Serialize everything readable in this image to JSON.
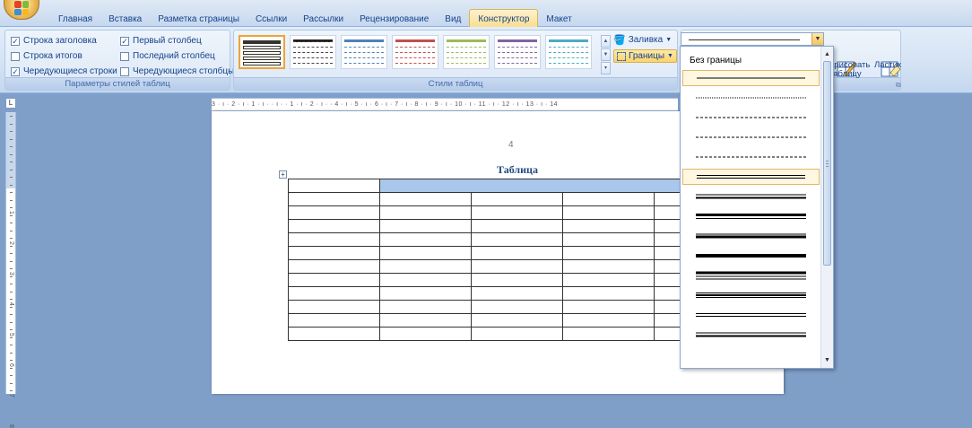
{
  "tabs": [
    {
      "label": "Главная",
      "active": false
    },
    {
      "label": "Вставка",
      "active": false
    },
    {
      "label": "Разметка страницы",
      "active": false
    },
    {
      "label": "Ссылки",
      "active": false
    },
    {
      "label": "Рассылки",
      "active": false
    },
    {
      "label": "Рецензирование",
      "active": false
    },
    {
      "label": "Вид",
      "active": false
    },
    {
      "label": "Конструктор",
      "active": true
    },
    {
      "label": "Макет",
      "active": false
    }
  ],
  "style_options": {
    "header_row": {
      "label": "Строка заголовка",
      "checked": true
    },
    "total_row": {
      "label": "Строка итогов",
      "checked": false
    },
    "banded_rows": {
      "label": "Чередующиеся строки",
      "checked": true
    },
    "first_column": {
      "label": "Первый столбец",
      "checked": true
    },
    "last_column": {
      "label": "Последний столбец",
      "checked": false
    },
    "banded_columns": {
      "label": "Чередующиеся столбцы",
      "checked": false
    },
    "group_title": "Параметры стилей таблиц"
  },
  "table_styles": {
    "group_title": "Стили таблиц",
    "tiles": [
      {
        "accent": "#555555",
        "selected": true
      },
      {
        "accent": "#404040",
        "selected": false
      },
      {
        "accent": "#4f81bd",
        "selected": false
      },
      {
        "accent": "#c0504d",
        "selected": false
      },
      {
        "accent": "#9bbb59",
        "selected": false
      },
      {
        "accent": "#8064a2",
        "selected": false
      },
      {
        "accent": "#4bacc6",
        "selected": false
      }
    ],
    "shading_label": "Заливка",
    "borders_label": "Границы"
  },
  "draw_borders": {
    "draw_table_label": "Нарисовать таблицу",
    "draw_table_visible_1": "арисовать",
    "draw_table_visible_2": "таблицу",
    "eraser_label": "Ластик"
  },
  "ruler": {
    "horizontal": "3 · ı · 2 · ı · 1 · ı ·  ·  ı · · 1 · ı · 2 · ı ·   · 4 · ı · 5 · ı · 6 · ı · 7 · ı · 8 · ı · 9 · ı · 10 · ı · 11 · ı · 12 · ı · 13 · ı · 14",
    "vertical_ticks": [
      "1",
      "2",
      "3",
      "4",
      "5",
      "6",
      "7",
      "8"
    ]
  },
  "document": {
    "page_number": "4",
    "table_title": "Таблица",
    "rows": 12
  },
  "line_style_dropdown": {
    "no_border_label": "Без границы",
    "styles": [
      {
        "kind": "solid",
        "selected": true
      },
      {
        "kind": "dotted",
        "selected": false
      },
      {
        "kind": "fine-dash",
        "selected": false
      },
      {
        "kind": "dash",
        "selected": false
      },
      {
        "kind": "dash-dot",
        "selected": false
      },
      {
        "kind": "double",
        "selected": true
      },
      {
        "kind": "thin-thick",
        "selected": false
      },
      {
        "kind": "thick-thin",
        "selected": false
      },
      {
        "kind": "thin-thick-2",
        "selected": false
      },
      {
        "kind": "thick",
        "selected": false
      },
      {
        "kind": "thick-thin-2",
        "selected": false
      },
      {
        "kind": "triple",
        "selected": false
      },
      {
        "kind": "thin-double",
        "selected": false
      },
      {
        "kind": "thin-thin",
        "selected": false
      }
    ]
  },
  "colors": {
    "accent": "#f7c458",
    "ribbon_text": "#15428b",
    "table_header_fill": "#a9c7ea",
    "app_background": "#7f9fc9"
  }
}
